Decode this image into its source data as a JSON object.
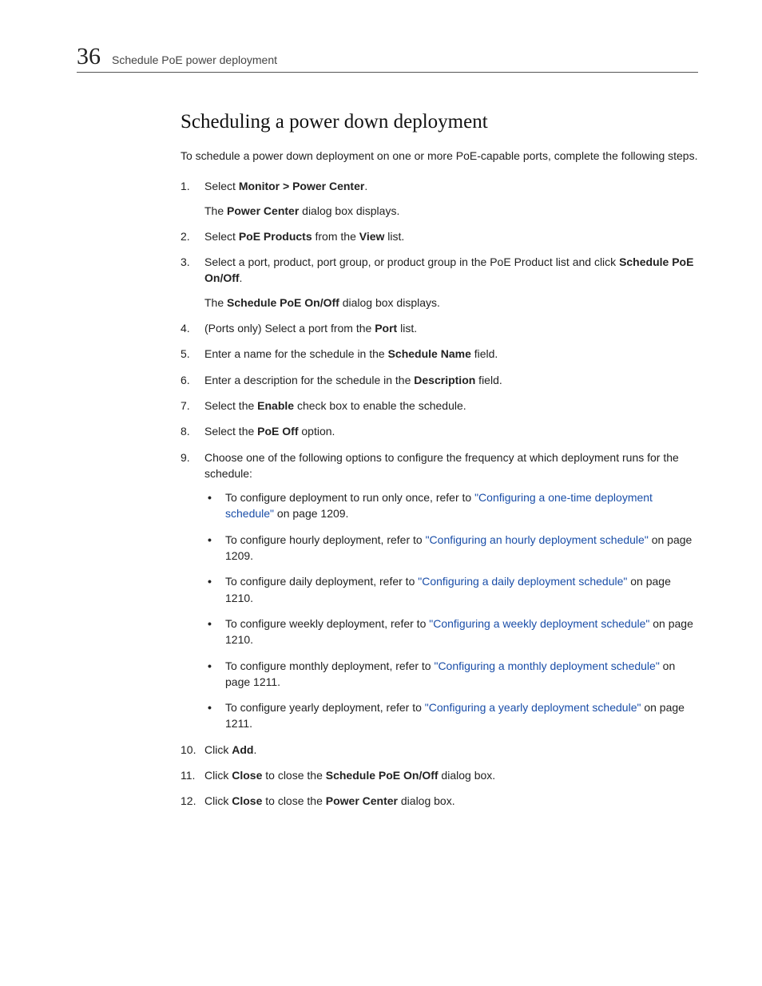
{
  "header": {
    "chapter_number": "36",
    "chapter_title": "Schedule PoE power deployment"
  },
  "title": "Scheduling a power down deployment",
  "intro": "To schedule a power down deployment on one or more PoE-capable ports, complete the following steps.",
  "step1": {
    "pre": "Select ",
    "b": "Monitor > Power Center",
    "post": ".",
    "sub_pre": "The ",
    "sub_b": "Power Center",
    "sub_post": " dialog box displays."
  },
  "step2": {
    "p1": "Select ",
    "b1": "PoE Products",
    "p2": " from the ",
    "b2": "View",
    "p3": " list."
  },
  "step3": {
    "p1": "Select a port, product, port group, or product group in the PoE Product list and click ",
    "b1": "Schedule PoE On/Off",
    "p2": ".",
    "sub_pre": "The ",
    "sub_b": "Schedule PoE On/Off",
    "sub_post": " dialog box displays."
  },
  "step4": {
    "p1": "(Ports only) Select a port from the ",
    "b1": "Port",
    "p2": " list."
  },
  "step5": {
    "p1": "Enter a name for the schedule in the ",
    "b1": "Schedule Name",
    "p2": " field."
  },
  "step6": {
    "p1": "Enter a description for the schedule in the ",
    "b1": "Description",
    "p2": " field."
  },
  "step7": {
    "p1": "Select the ",
    "b1": "Enable",
    "p2": " check box to enable the schedule."
  },
  "step8": {
    "p1": "Select the ",
    "b1": "PoE Off",
    "p2": " option."
  },
  "step9": {
    "lead": "Choose one of the following options to configure the frequency at which deployment runs for the schedule:",
    "items": [
      {
        "pre": "To configure deployment to run only once, refer to ",
        "link": "\"Configuring a one-time deployment schedule\"",
        "post": " on page 1209."
      },
      {
        "pre": "To configure hourly deployment, refer to ",
        "link": "\"Configuring an hourly deployment schedule\"",
        "post": " on page 1209."
      },
      {
        "pre": "To configure daily deployment, refer to ",
        "link": "\"Configuring a daily deployment schedule\"",
        "post": " on page 1210."
      },
      {
        "pre": "To configure weekly deployment, refer to ",
        "link": "\"Configuring a weekly deployment schedule\"",
        "post": " on page 1210."
      },
      {
        "pre": "To configure monthly deployment, refer to ",
        "link": "\"Configuring a monthly deployment schedule\"",
        "post": " on page 1211."
      },
      {
        "pre": "To configure yearly deployment, refer to ",
        "link": "\"Configuring a yearly deployment schedule\"",
        "post": " on page 1211."
      }
    ]
  },
  "step10": {
    "p1": "Click ",
    "b1": "Add",
    "p2": "."
  },
  "step11": {
    "p1": "Click ",
    "b1": "Close",
    "p2": " to close the ",
    "b2": "Schedule PoE On/Off",
    "p3": " dialog box."
  },
  "step12": {
    "p1": "Click ",
    "b1": "Close",
    "p2": " to close the ",
    "b2": "Power Center",
    "p3": " dialog box."
  }
}
